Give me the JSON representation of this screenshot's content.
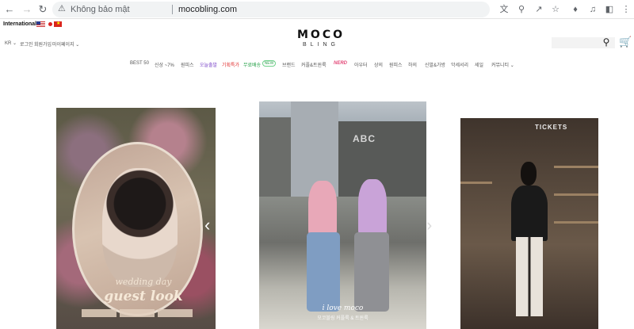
{
  "browser": {
    "security_label": "Không bảo mật",
    "url": "mocobling.com"
  },
  "header": {
    "international": "International",
    "util_links": [
      "KR",
      "로그인",
      "회원가입",
      "마이페이지"
    ],
    "logo_main": "MOCO",
    "logo_sub": "BLING"
  },
  "menu": {
    "items": [
      "BEST 50",
      "신상 ~7%",
      "원피스",
      "오늘출발",
      "기획특가",
      "무료배송",
      "브랜드",
      "커플&트윈룩",
      "NERD",
      "아우터",
      "상의",
      "원피스",
      "하의",
      "신발&가방",
      "악세서리",
      "세일",
      "커뮤니티"
    ],
    "badge": "NEW",
    "item_colors": {
      "오늘출발": "#7b45c8",
      "기획특가": "#e02c2c",
      "무료배송": "#24a046",
      "NERD": "#e34b7a"
    }
  },
  "slides": {
    "slide1": {
      "line1": "wedding day",
      "line2": "guest look"
    },
    "slide2": {
      "sign": "ABC",
      "line1": "i love moco",
      "line2": "모코블링 커플룩 & 트윈룩"
    },
    "slide3": {
      "sign": "TICKETS"
    }
  }
}
